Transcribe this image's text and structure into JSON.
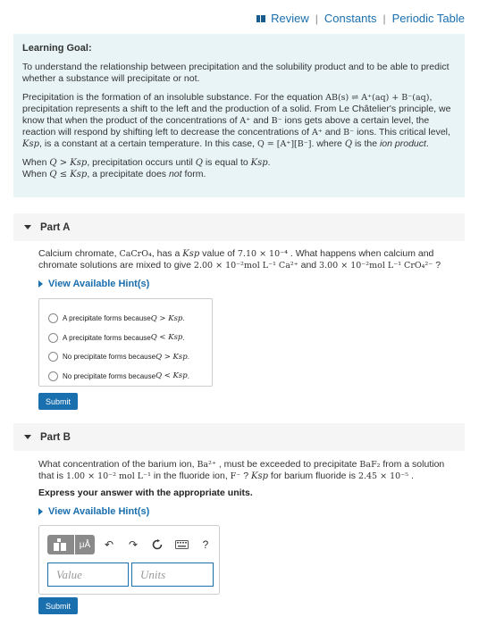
{
  "header": {
    "links": [
      "Review",
      "Constants",
      "Periodic Table"
    ]
  },
  "goal": {
    "heading": "Learning Goal:",
    "intro": "To understand the relationship between precipitation and the solubility product and to be able to predict whether a substance will precipitate or not.",
    "p2_a": "Precipitation is the formation of an insoluble substance. For the equation ",
    "p2_eq": "AB(s) ⇌ A⁺(aq) + B⁻(aq)",
    "p2_b": ", precipitation represents a shift to the left and the production of a solid. From Le Châtelier's principle, we know that when the product of the concentrations of ",
    "p2_A": "A⁺",
    "p2_and": " and ",
    "p2_B": "B⁻",
    "p2_c": " ions gets above a certain level, the reaction will respond by shifting left to decrease the concentrations of ",
    "p2_d": " ions. This critical level, ",
    "p2_ksp": "Ksp",
    "p2_e": ", is a constant at a certain temperature. In this case, ",
    "p2_q": "Q = [A⁺][B⁻]",
    "p2_f": ". where ",
    "p2_Qv": "Q",
    "p2_g": " is the ",
    "p2_h": "ion product",
    "p2_i": ".",
    "line1_a": "When ",
    "line1_m": "Q > Ksp",
    "line1_b": ", precipitation occurs until ",
    "line1_q": "Q",
    "line1_c": " is equal to ",
    "line1_k": "Ksp",
    "line1_d": ".",
    "line2_a": "When ",
    "line2_m": "Q ≤ Ksp",
    "line2_b": ", a precipitate does ",
    "line2_not": "not",
    "line2_c": " form."
  },
  "partA": {
    "title": "Part A",
    "q_a": "Calcium chromate, ",
    "q_f": "CaCrO₄",
    "q_b": ", has a ",
    "q_ksp": "Ksp",
    "q_c": " value of ",
    "q_val": "7.10 × 10⁻⁴",
    "q_d": " . What happens when calcium and chromate solutions are mixed to give ",
    "q_c1": "2.00 × 10⁻²mol L⁻¹ Ca²⁺",
    "q_e": " and ",
    "q_c2": "3.00 × 10⁻²mol L⁻¹ CrO₄²⁻",
    "q_f2": " ?",
    "hint": "View Available Hint(s)",
    "options": [
      {
        "text": "A precipitate forms because ",
        "math": "Q > Ksp",
        "end": "."
      },
      {
        "text": "A precipitate forms because ",
        "math": "Q < Ksp",
        "end": "."
      },
      {
        "text": "No precipitate forms because ",
        "math": "Q > Ksp",
        "end": "."
      },
      {
        "text": "No precipitate forms because ",
        "math": "Q < Ksp",
        "end": "."
      }
    ],
    "submit": "Submit"
  },
  "partB": {
    "title": "Part B",
    "q_a": "What concentration of the barium ion, ",
    "q_ba": "Ba²⁺",
    "q_b": " , must be exceeded to precipitate ",
    "q_baf": "BaF₂",
    "q_c": "  from a solution that is ",
    "q_conc": "1.00 × 10⁻² mol L⁻¹",
    "q_d": " in the fluoride ion, ",
    "q_f": "F⁻",
    "q_e": " ? ",
    "q_ksp": "Ksp",
    "q_g": " for barium fluoride is ",
    "q_val": "2.45 × 10⁻⁵",
    "q_h": " .",
    "instruction": "Express your answer with the appropriate units.",
    "hint": "View Available Hint(s)",
    "toolbar": {
      "units_btn": "μÅ",
      "help": "?"
    },
    "value_placeholder": "Value",
    "units_placeholder": "Units",
    "submit": "Submit"
  }
}
